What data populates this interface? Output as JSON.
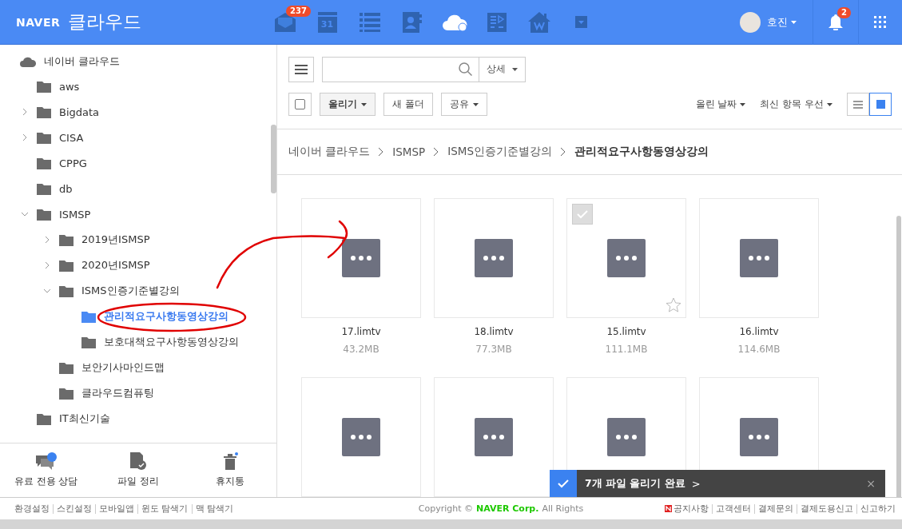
{
  "header": {
    "logo": "NAVER",
    "title": "클라우드",
    "apps": [
      {
        "kind": "mail",
        "badge": "237",
        "selected": false
      },
      {
        "kind": "calendar",
        "label": "31",
        "selected": false
      },
      {
        "kind": "list",
        "selected": false
      },
      {
        "kind": "contacts",
        "selected": false
      },
      {
        "kind": "cloud",
        "selected": true
      },
      {
        "kind": "report",
        "selected": false
      },
      {
        "kind": "house",
        "selected": false
      },
      {
        "kind": "more",
        "selected": false
      }
    ],
    "user": "호진",
    "notifications": "2"
  },
  "tree": {
    "root": "네이버 클라우드",
    "items": [
      {
        "label": "aws",
        "selected": false
      },
      {
        "label": "Bigdata",
        "expanded": false,
        "selected": false
      },
      {
        "label": "CISA",
        "expanded": false,
        "selected": false
      },
      {
        "label": "CPPG",
        "selected": false
      },
      {
        "label": "db",
        "selected": false
      },
      {
        "label": "ISMSP",
        "expanded": true,
        "selected": false,
        "children": [
          {
            "label": "2019년ISMSP",
            "expanded": false,
            "selected": false
          },
          {
            "label": "2020년ISMSP",
            "expanded": false,
            "selected": false
          },
          {
            "label": "ISMS인증기준별강의",
            "expanded": true,
            "selected": false,
            "children": [
              {
                "label": "관리적요구사항동영상강의",
                "selected": true
              },
              {
                "label": "보호대책요구사항동영상강의",
                "selected": false
              }
            ]
          },
          {
            "label": "보안기사마인드맵",
            "selected": false
          },
          {
            "label": "클라우드컴퓨팅",
            "selected": false
          }
        ]
      },
      {
        "label": "IT최신기술",
        "selected": false
      }
    ]
  },
  "tools": [
    {
      "kind": "consult",
      "label": "유료 전용 상담"
    },
    {
      "kind": "organize",
      "label": "파일 정리"
    },
    {
      "kind": "trash",
      "label": "휴지통"
    }
  ],
  "toolbar": {
    "select_all": {
      "checked": false
    },
    "detail": "상세",
    "upload": "올리기",
    "new_folder": "새 폴더",
    "share": "공유",
    "sort": "올린 날짜",
    "order": "최신 항목 우선",
    "views": [
      {
        "kind": "list",
        "selected": false
      },
      {
        "kind": "grid",
        "selected": true
      }
    ]
  },
  "breadcrumb": [
    "네이버 클라우드",
    "ISMSP",
    "ISMS인증기준별강의",
    "관리적요구사항동영상강의"
  ],
  "files": [
    {
      "name": "17.limtv",
      "size": "43.2MB",
      "hovered": false
    },
    {
      "name": "18.limtv",
      "size": "77.3MB",
      "hovered": false
    },
    {
      "name": "15.limtv",
      "size": "111.1MB",
      "hovered": true
    },
    {
      "name": "16.limtv",
      "size": "114.6MB",
      "hovered": false
    },
    {
      "hovered": false
    },
    {
      "hovered": false
    },
    {
      "hovered": false
    },
    {
      "hovered": false
    }
  ],
  "toast": {
    "message": "7개 파일 올리기 완료",
    "link": ">",
    "close": "×"
  },
  "footer": {
    "left_links": [
      "환경설정",
      "스킨설정",
      "모바일앱",
      "윈도 탐색기",
      "맥 탐색기"
    ],
    "copyright": "Copyright ©",
    "company": "NAVER Corp.",
    "rights": "All Rights",
    "right_links": [
      "공지사항",
      "고객센터",
      "결제문의",
      "결제도용신고",
      "신고하기"
    ]
  }
}
